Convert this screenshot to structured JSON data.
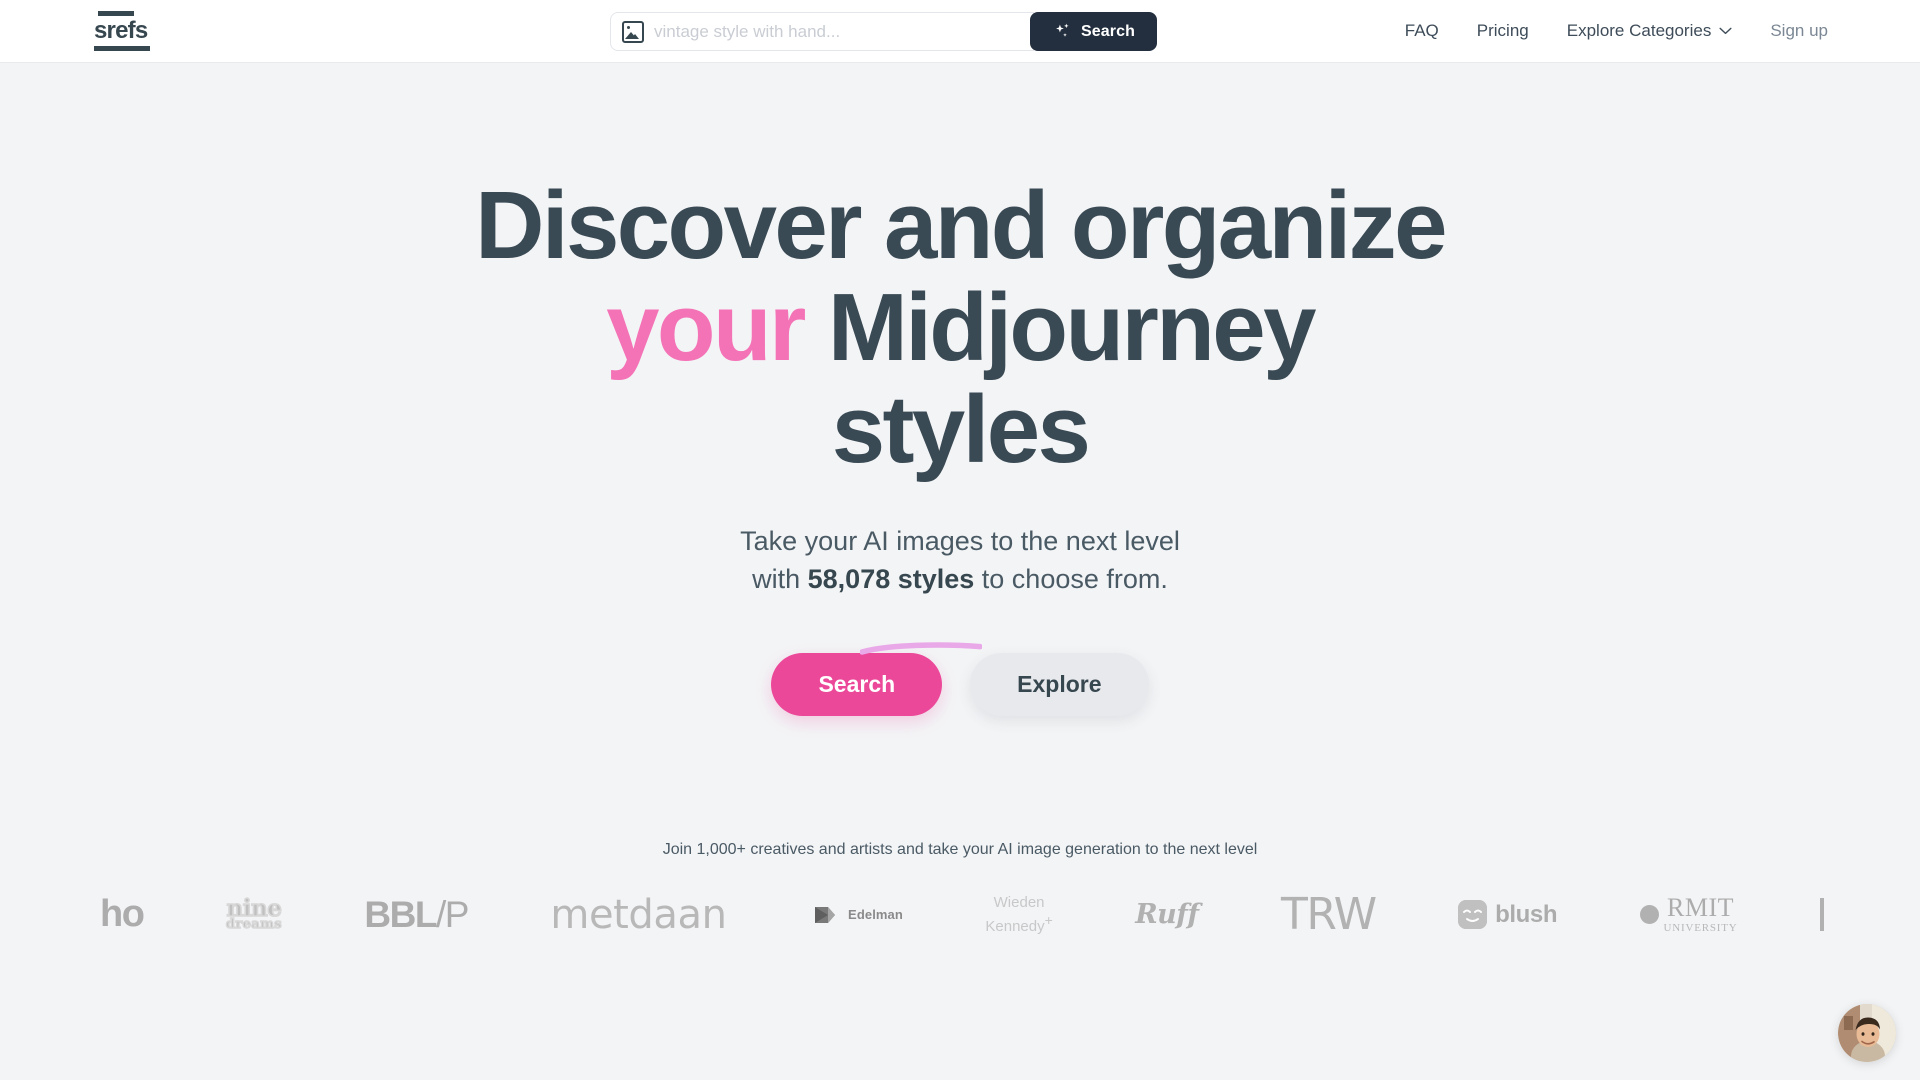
{
  "header": {
    "logo": {
      "word": "srefs",
      "name": "srefs-logo"
    },
    "search": {
      "placeholder": "vintage style with hand...",
      "value": "",
      "icon": "image-icon",
      "button_label": "Search",
      "button_icon": "sparkles-icon"
    },
    "nav": [
      {
        "label": "FAQ",
        "name": "nav-faq",
        "muted": false,
        "dropdown": false
      },
      {
        "label": "Pricing",
        "name": "nav-pricing",
        "muted": false,
        "dropdown": false
      },
      {
        "label": "Explore Categories",
        "name": "nav-explore-categories",
        "muted": false,
        "dropdown": true
      },
      {
        "label": "Sign up",
        "name": "nav-sign-up",
        "muted": true,
        "dropdown": false
      }
    ],
    "chevron_icon": "chevron-down-icon"
  },
  "hero": {
    "headline_line1": "Discover and organize",
    "headline_accent": "your",
    "headline_line2_rest": "Midjourney",
    "headline_line3": "styles",
    "sub_line1": "Take your AI images to the next level",
    "sub_line2_pre": "with ",
    "sub_line2_bold": "58,078 styles",
    "sub_line2_post": " to choose from.",
    "cta_primary": "Search",
    "cta_secondary": "Explore"
  },
  "social_proof": {
    "text": "Join 1,000+ creatives and artists and take your AI image generation to the next level",
    "logos": [
      {
        "name": "logo-ho",
        "label": "ho",
        "kind": "ho"
      },
      {
        "name": "logo-nine-dreams",
        "label": "nine",
        "label2": "dreams",
        "kind": "nine"
      },
      {
        "name": "logo-bbl-p",
        "label": "BBL",
        "label2": "/P",
        "kind": "bbl"
      },
      {
        "name": "logo-metdaan",
        "label": "metdaan",
        "kind": "metdaan"
      },
      {
        "name": "logo-edelman",
        "label": "Edelman",
        "kind": "edelman"
      },
      {
        "name": "logo-wieden-kennedy",
        "label": "Wieden",
        "label2": "Kennedy",
        "kind": "wk"
      },
      {
        "name": "logo-ruff",
        "label": "Ruff",
        "kind": "ruff"
      },
      {
        "name": "logo-trw",
        "label": "TRW",
        "kind": "trw"
      },
      {
        "name": "logo-blush",
        "label": "blush",
        "kind": "blush"
      },
      {
        "name": "logo-rmit",
        "label": "RMIT",
        "label2": "UNIVERSITY",
        "kind": "rmit"
      },
      {
        "name": "logo-partial-bar",
        "label": "",
        "kind": "bar"
      }
    ]
  },
  "chat": {
    "name": "chat-avatar-widget",
    "icon": "avatar-photo"
  },
  "colors": {
    "accent_pink": "#ec4899",
    "accent_pink_light": "#f472b6",
    "underline_violet": "#e9a8e8",
    "dark_slate": "#37474f",
    "button_dark": "#232f3e",
    "page_bg": "#f3f4f6",
    "header_bg": "#ffffff",
    "logo_gray": "#a7abaf"
  }
}
